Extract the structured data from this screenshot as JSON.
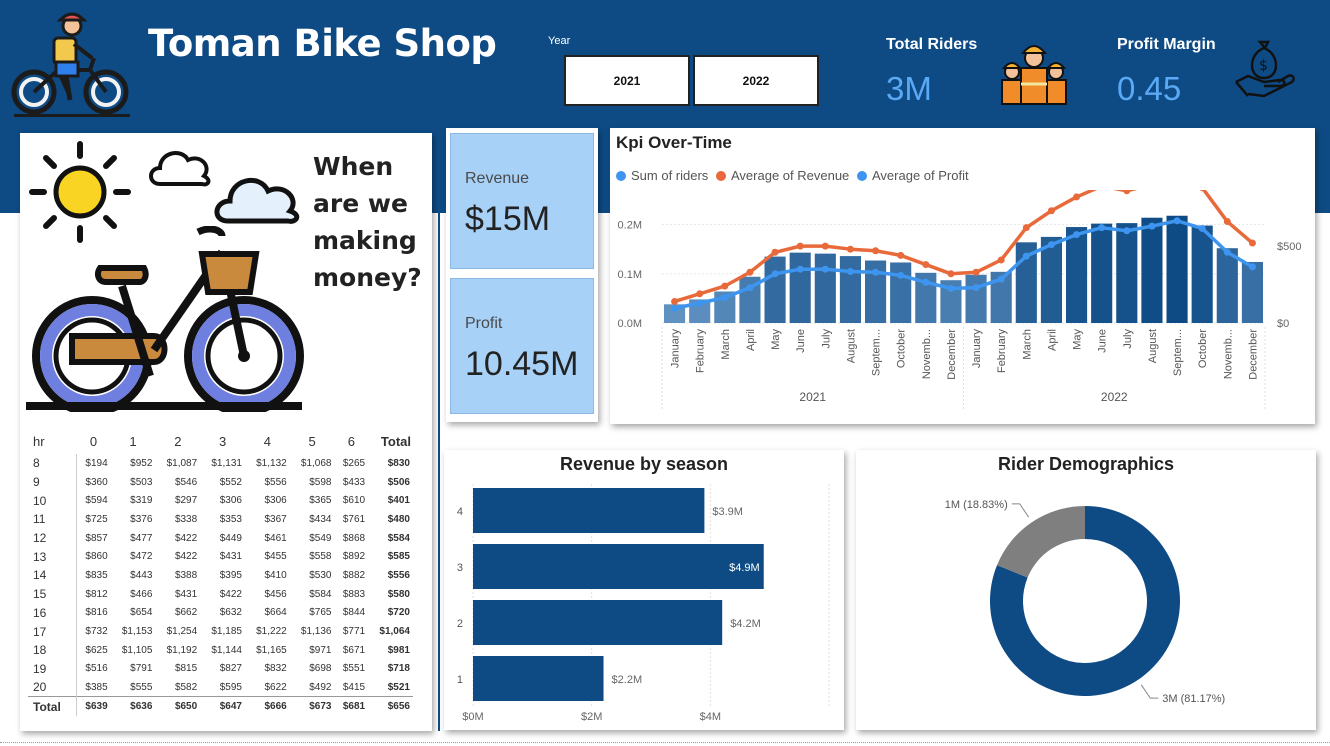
{
  "header": {
    "title": "Toman Bike Shop",
    "year_label": "Year",
    "year_options": [
      "2021",
      "2022"
    ],
    "total_riders_label": "Total Riders",
    "total_riders_value": "3M",
    "profit_margin_label": "Profit Margin",
    "profit_margin_value": "0.45"
  },
  "hero": {
    "question": [
      "When",
      "are we",
      "making",
      "money?"
    ]
  },
  "cards": {
    "revenue_label": "Revenue",
    "revenue_value": "$15M",
    "profit_label": "Profit",
    "profit_value": "10.45M"
  },
  "matrix": {
    "columns": [
      "hr",
      "0",
      "1",
      "2",
      "3",
      "4",
      "5",
      "6",
      "Total"
    ],
    "rows": [
      [
        "8",
        "$194",
        "$952",
        "$1,087",
        "$1,131",
        "$1,132",
        "$1,068",
        "$265",
        "$830"
      ],
      [
        "9",
        "$360",
        "$503",
        "$546",
        "$552",
        "$556",
        "$598",
        "$433",
        "$506"
      ],
      [
        "10",
        "$594",
        "$319",
        "$297",
        "$306",
        "$306",
        "$365",
        "$610",
        "$401"
      ],
      [
        "11",
        "$725",
        "$376",
        "$338",
        "$353",
        "$367",
        "$434",
        "$761",
        "$480"
      ],
      [
        "12",
        "$857",
        "$477",
        "$422",
        "$449",
        "$461",
        "$549",
        "$868",
        "$584"
      ],
      [
        "13",
        "$860",
        "$472",
        "$422",
        "$431",
        "$455",
        "$558",
        "$892",
        "$585"
      ],
      [
        "14",
        "$835",
        "$443",
        "$388",
        "$395",
        "$410",
        "$530",
        "$882",
        "$556"
      ],
      [
        "15",
        "$812",
        "$466",
        "$431",
        "$422",
        "$456",
        "$584",
        "$883",
        "$580"
      ],
      [
        "16",
        "$816",
        "$654",
        "$662",
        "$632",
        "$664",
        "$765",
        "$844",
        "$720"
      ],
      [
        "17",
        "$732",
        "$1,153",
        "$1,254",
        "$1,185",
        "$1,222",
        "$1,136",
        "$771",
        "$1,064"
      ],
      [
        "18",
        "$625",
        "$1,105",
        "$1,192",
        "$1,144",
        "$1,165",
        "$971",
        "$671",
        "$981"
      ],
      [
        "19",
        "$516",
        "$791",
        "$815",
        "$827",
        "$832",
        "$698",
        "$551",
        "$718"
      ],
      [
        "20",
        "$385",
        "$555",
        "$582",
        "$595",
        "$622",
        "$492",
        "$415",
        "$521"
      ],
      [
        "Total",
        "$639",
        "$636",
        "$650",
        "$647",
        "$666",
        "$673",
        "$681",
        "$656"
      ]
    ]
  },
  "colors": {
    "header_bg": "#0e4b85",
    "accent_blue": "#5aa9f5",
    "card_blue": "#a8d1f7",
    "bar_dark": "#0e4b85",
    "revenue_line": "#e8693a",
    "profit_line": "#3d95ef",
    "donut_gray": "#7f7f7f"
  },
  "chart_data": [
    {
      "type": "bar",
      "title": "Kpi Over-Time",
      "legend": [
        "Sum of riders",
        "Average of Revenue",
        "Average of Profit"
      ],
      "legend_position": "top-left",
      "months": [
        "January",
        "February",
        "March",
        "April",
        "May",
        "June",
        "July",
        "August",
        "Septem...",
        "October",
        "Novemb...",
        "December",
        "January",
        "February",
        "March",
        "April",
        "May",
        "June",
        "July",
        "August",
        "Septem...",
        "October",
        "Novemb...",
        "December"
      ],
      "years": [
        "2021",
        "2022"
      ],
      "left_axis_ticks": [
        "0.0M",
        "0.1M",
        "0.2M"
      ],
      "right_axis_ticks": [
        "$0",
        "$500"
      ],
      "ylim_left": [
        0,
        0.25
      ],
      "ylim_right": [
        0,
        800
      ],
      "series": [
        {
          "name": "Sum of riders",
          "axis": "left",
          "values": [
            0.038,
            0.048,
            0.064,
            0.094,
            0.135,
            0.143,
            0.141,
            0.136,
            0.127,
            0.123,
            0.102,
            0.087,
            0.098,
            0.104,
            0.164,
            0.175,
            0.195,
            0.202,
            0.203,
            0.214,
            0.218,
            0.198,
            0.152,
            0.124
          ]
        },
        {
          "name": "Average of Revenue",
          "axis": "right",
          "values": [
            140,
            190,
            240,
            330,
            460,
            500,
            500,
            480,
            470,
            440,
            380,
            320,
            330,
            410,
            620,
            730,
            820,
            890,
            860,
            900,
            950,
            880,
            660,
            520
          ]
        },
        {
          "name": "Average of Profit",
          "axis": "right",
          "values": [
            95,
            130,
            165,
            230,
            320,
            350,
            350,
            335,
            330,
            310,
            265,
            225,
            230,
            285,
            435,
            510,
            575,
            620,
            600,
            630,
            665,
            615,
            460,
            365
          ]
        }
      ]
    },
    {
      "type": "bar",
      "orientation": "horizontal",
      "title": "Revenue by season",
      "categories": [
        "4",
        "3",
        "2",
        "1"
      ],
      "values": [
        3.9,
        4.9,
        4.2,
        2.2
      ],
      "data_labels": [
        "$3.9M",
        "$4.9M",
        "$4.2M",
        "$2.2M"
      ],
      "x_ticks": [
        "$0M",
        "$2M",
        "$4M"
      ],
      "xlim": [
        0,
        6
      ]
    },
    {
      "type": "pie",
      "title": "Rider Demographics",
      "donut": true,
      "slices": [
        {
          "label": "3M (81.17%)",
          "value": 81.17,
          "color": "#0e4b85"
        },
        {
          "label": "1M (18.83%)",
          "value": 18.83,
          "color": "#7f7f7f"
        }
      ]
    }
  ]
}
